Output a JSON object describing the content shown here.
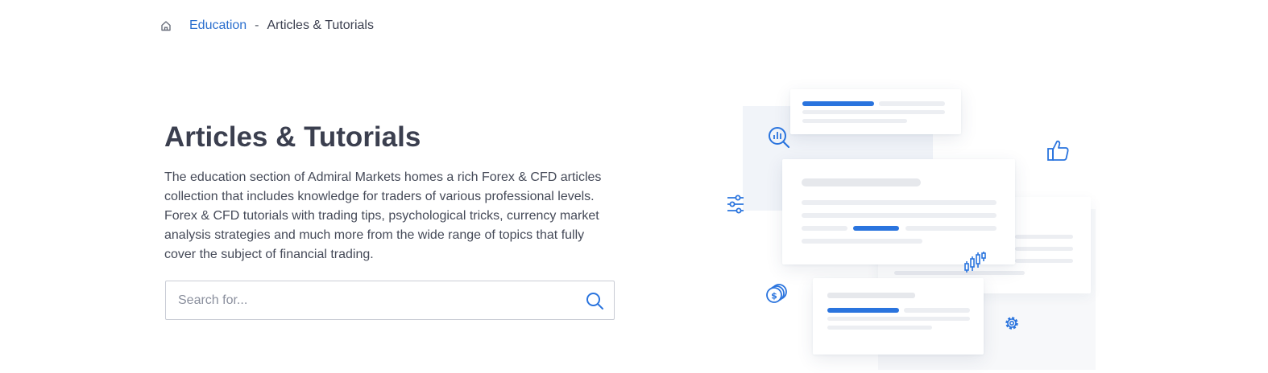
{
  "breadcrumb": {
    "home_icon": "home-icon",
    "link_label": "Education",
    "separator": "-",
    "current_label": "Articles & Tutorials"
  },
  "hero": {
    "title": "Articles & Tutorials",
    "description": "The education section of Admiral Markets homes a rich Forex & CFD articles collection that includes knowledge for traders of various professional levels. Forex & CFD tutorials with trading tips, psychological tricks, currency market analysis strategies and much more from the wide range of topics that fully cover the subject of financial trading."
  },
  "search": {
    "placeholder": "Search for...",
    "value": "",
    "icon": "search-icon"
  },
  "illustration": {
    "icons": [
      "analytics-search-icon",
      "filter-sliders-icon",
      "coins-dollar-icon",
      "thumbs-up-icon",
      "candlestick-chart-icon",
      "gear-icon"
    ]
  },
  "colors": {
    "accent": "#2a74de",
    "link": "#2b6fce",
    "text": "#3b3f4f",
    "border": "#c9ccd5"
  }
}
